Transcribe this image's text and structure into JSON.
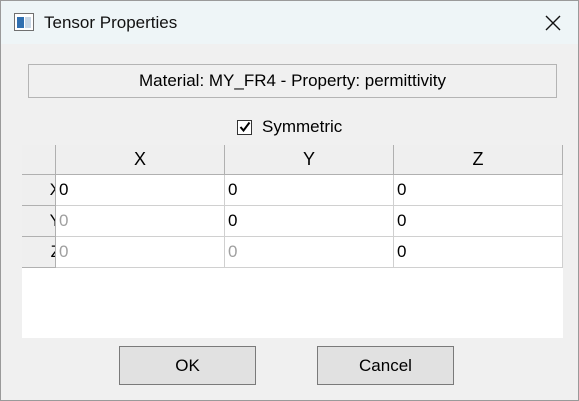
{
  "window": {
    "title": "Tensor Properties",
    "close_icon": "close-icon"
  },
  "header": {
    "text": "Material:  MY_FR4 - Property:  permittivity"
  },
  "symmetric": {
    "label": "Symmetric",
    "checked": true
  },
  "grid": {
    "columns": [
      "X",
      "Y",
      "Z"
    ],
    "rows": [
      {
        "label": "X",
        "cells": [
          "0",
          "0",
          "0"
        ]
      },
      {
        "label": "Y",
        "cells": [
          "0",
          "0",
          "0"
        ]
      },
      {
        "label": "Z",
        "cells": [
          "0",
          "0",
          "0"
        ]
      }
    ]
  },
  "buttons": {
    "ok": "OK",
    "cancel": "Cancel"
  }
}
